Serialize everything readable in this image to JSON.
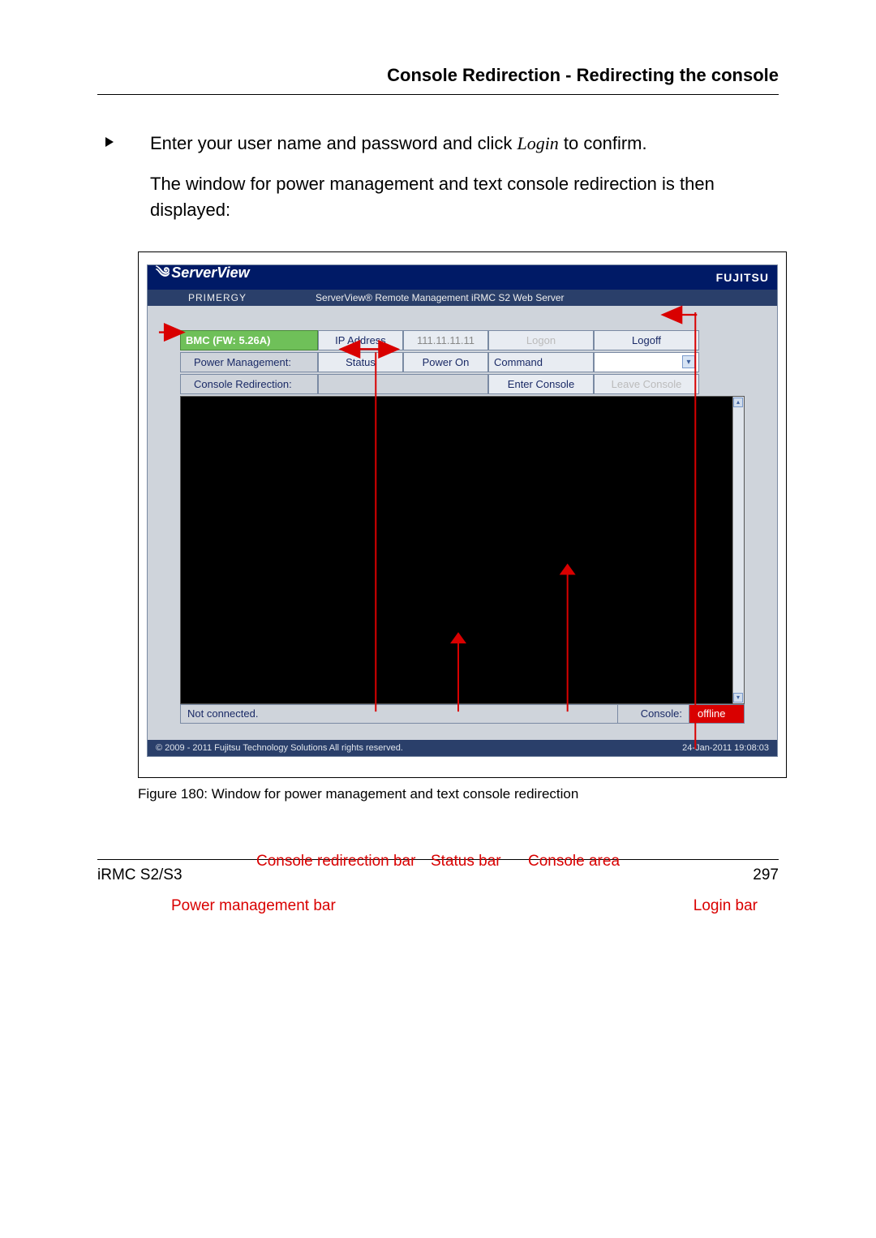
{
  "header": {
    "title": "Console Redirection - Redirecting the console"
  },
  "bullet": {
    "pre": "Enter your user name and password and click ",
    "login_italic": "Login",
    "post": " to confirm."
  },
  "body_para": "The window for power management and text console redirection is then displayed:",
  "screenshot": {
    "title": "ServerView",
    "brand": "FUJITSU",
    "subhead_left": "PRIMERGY",
    "subhead_right": "ServerView® Remote Management iRMC S2 Web Server",
    "rows": {
      "bmc_label": "BMC (FW: 5.26A)",
      "ip_label": "IP Address",
      "ip_value": "111.11.11.11",
      "logon": "Logon",
      "logoff": "Logoff",
      "pm_label": "Power Management:",
      "status_label": "Status",
      "status_value": "Power On",
      "command_label": "Command",
      "cr_label": "Console Redirection:",
      "enter_console": "Enter Console",
      "leave_console": "Leave Console"
    },
    "statusbar": {
      "left": "Not connected.",
      "console_label": "Console:",
      "console_value": "offline"
    },
    "footer_copyright": "© 2009 - 2011 Fujitsu Technology Solutions All rights reserved.",
    "footer_date": "24-Jan-2011 19:08:03"
  },
  "annotations": {
    "console_redirection_bar": "Console redirection bar",
    "status_bar": "Status bar",
    "console_area": "Console area",
    "power_mgmt_bar": "Power management bar",
    "login_bar": "Login bar"
  },
  "caption": "Figure 180: Window for power management and text console redirection",
  "page_footer": {
    "left": "iRMC S2/S3",
    "right": "297"
  }
}
